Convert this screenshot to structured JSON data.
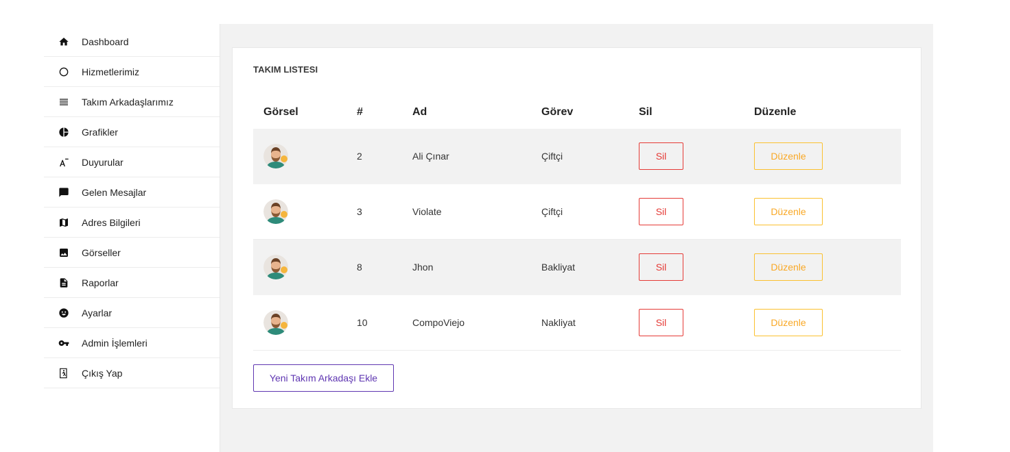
{
  "sidebar": {
    "items": [
      {
        "label": "Dashboard",
        "icon": "home-icon"
      },
      {
        "label": "Hizmetlerimiz",
        "icon": "circle-icon"
      },
      {
        "label": "Takım Arkadaşlarımız",
        "icon": "list-icon"
      },
      {
        "label": "Grafikler",
        "icon": "pie-chart-icon"
      },
      {
        "label": "Duyurular",
        "icon": "text-format-icon"
      },
      {
        "label": "Gelen Mesajlar",
        "icon": "message-icon"
      },
      {
        "label": "Adres Bilgileri",
        "icon": "map-icon"
      },
      {
        "label": "Görseller",
        "icon": "image-icon"
      },
      {
        "label": "Raporlar",
        "icon": "document-icon"
      },
      {
        "label": "Ayarlar",
        "icon": "face-icon"
      },
      {
        "label": "Admin İşlemleri",
        "icon": "key-icon"
      },
      {
        "label": "Çıkış Yap",
        "icon": "exit-icon"
      }
    ]
  },
  "card": {
    "title": "TAKIM LISTESI",
    "headers": {
      "image": "Görsel",
      "number": "#",
      "name": "Ad",
      "role": "Görev",
      "delete": "Sil",
      "edit": "Düzenle"
    },
    "rows": [
      {
        "number": "2",
        "name": "Ali Çınar",
        "role": "Çiftçi",
        "delete_label": "Sil",
        "edit_label": "Düzenle"
      },
      {
        "number": "3",
        "name": "Violate",
        "role": "Çiftçi",
        "delete_label": "Sil",
        "edit_label": "Düzenle"
      },
      {
        "number": "8",
        "name": "Jhon",
        "role": "Bakliyat",
        "delete_label": "Sil",
        "edit_label": "Düzenle"
      },
      {
        "number": "10",
        "name": "CompoViejo",
        "role": "Nakliyat",
        "delete_label": "Sil",
        "edit_label": "Düzenle"
      }
    ],
    "add_button": "Yeni Takım Arkadaşı Ekle"
  },
  "colors": {
    "danger": "#e53935",
    "warning": "#fbc02d",
    "primary": "#5e35b1",
    "panel_bg": "#f2f2f2"
  }
}
